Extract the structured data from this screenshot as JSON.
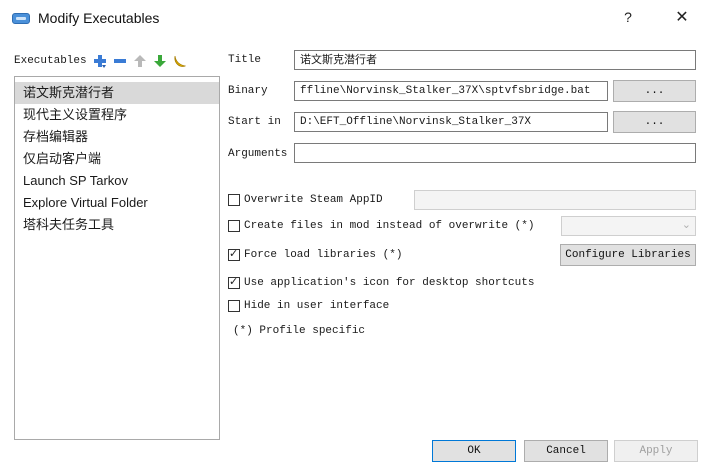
{
  "window": {
    "title": "Modify Executables",
    "help": "?",
    "close": "✕"
  },
  "executables": {
    "label": "Executables",
    "toolbar": [
      {
        "name": "add-icon",
        "color": "#3a7bd5"
      },
      {
        "name": "remove-icon",
        "color": "#3a7bd5"
      },
      {
        "name": "move-up-icon",
        "color": "#b9b9b9"
      },
      {
        "name": "move-down-icon",
        "color": "#3aa83a"
      },
      {
        "name": "banana-icon",
        "color": "#e5b400"
      }
    ],
    "items": [
      {
        "label": "诺文斯克潜行者",
        "selected": true
      },
      {
        "label": "现代主义设置程序",
        "selected": false
      },
      {
        "label": "存档编辑器",
        "selected": false
      },
      {
        "label": "仅启动客户端",
        "selected": false
      },
      {
        "label": "Launch SP Tarkov",
        "selected": false
      },
      {
        "label": "Explore Virtual Folder",
        "selected": false
      },
      {
        "label": "塔科夫任务工具",
        "selected": false
      }
    ]
  },
  "form": {
    "title_label": "Title",
    "title_value": "诺文斯克潜行者",
    "binary_label": "Binary",
    "binary_value": "ffline\\Norvinsk_Stalker_37X\\sptvfsbridge.bat",
    "binary_browse": "...",
    "start_in_label": "Start in",
    "start_in_value": "D:\\EFT_Offline\\Norvinsk_Stalker_37X",
    "start_in_browse": "...",
    "arguments_label": "Arguments",
    "arguments_value": ""
  },
  "options": {
    "overwrite_steam_appid": {
      "label": "Overwrite Steam AppID",
      "checked": false
    },
    "create_files_in_mod": {
      "label": "Create files in mod instead of overwrite (*)",
      "checked": false
    },
    "force_load_libraries": {
      "label": "Force load libraries (*)",
      "checked": true
    },
    "configure_libraries": "Configure Libraries",
    "use_app_icon": {
      "label": "Use application's icon for desktop shortcuts",
      "checked": true
    },
    "hide_in_ui": {
      "label": "Hide in user interface",
      "checked": false
    },
    "profile_note": "(*) Profile specific"
  },
  "buttons": {
    "ok": "OK",
    "cancel": "Cancel",
    "apply": "Apply"
  }
}
